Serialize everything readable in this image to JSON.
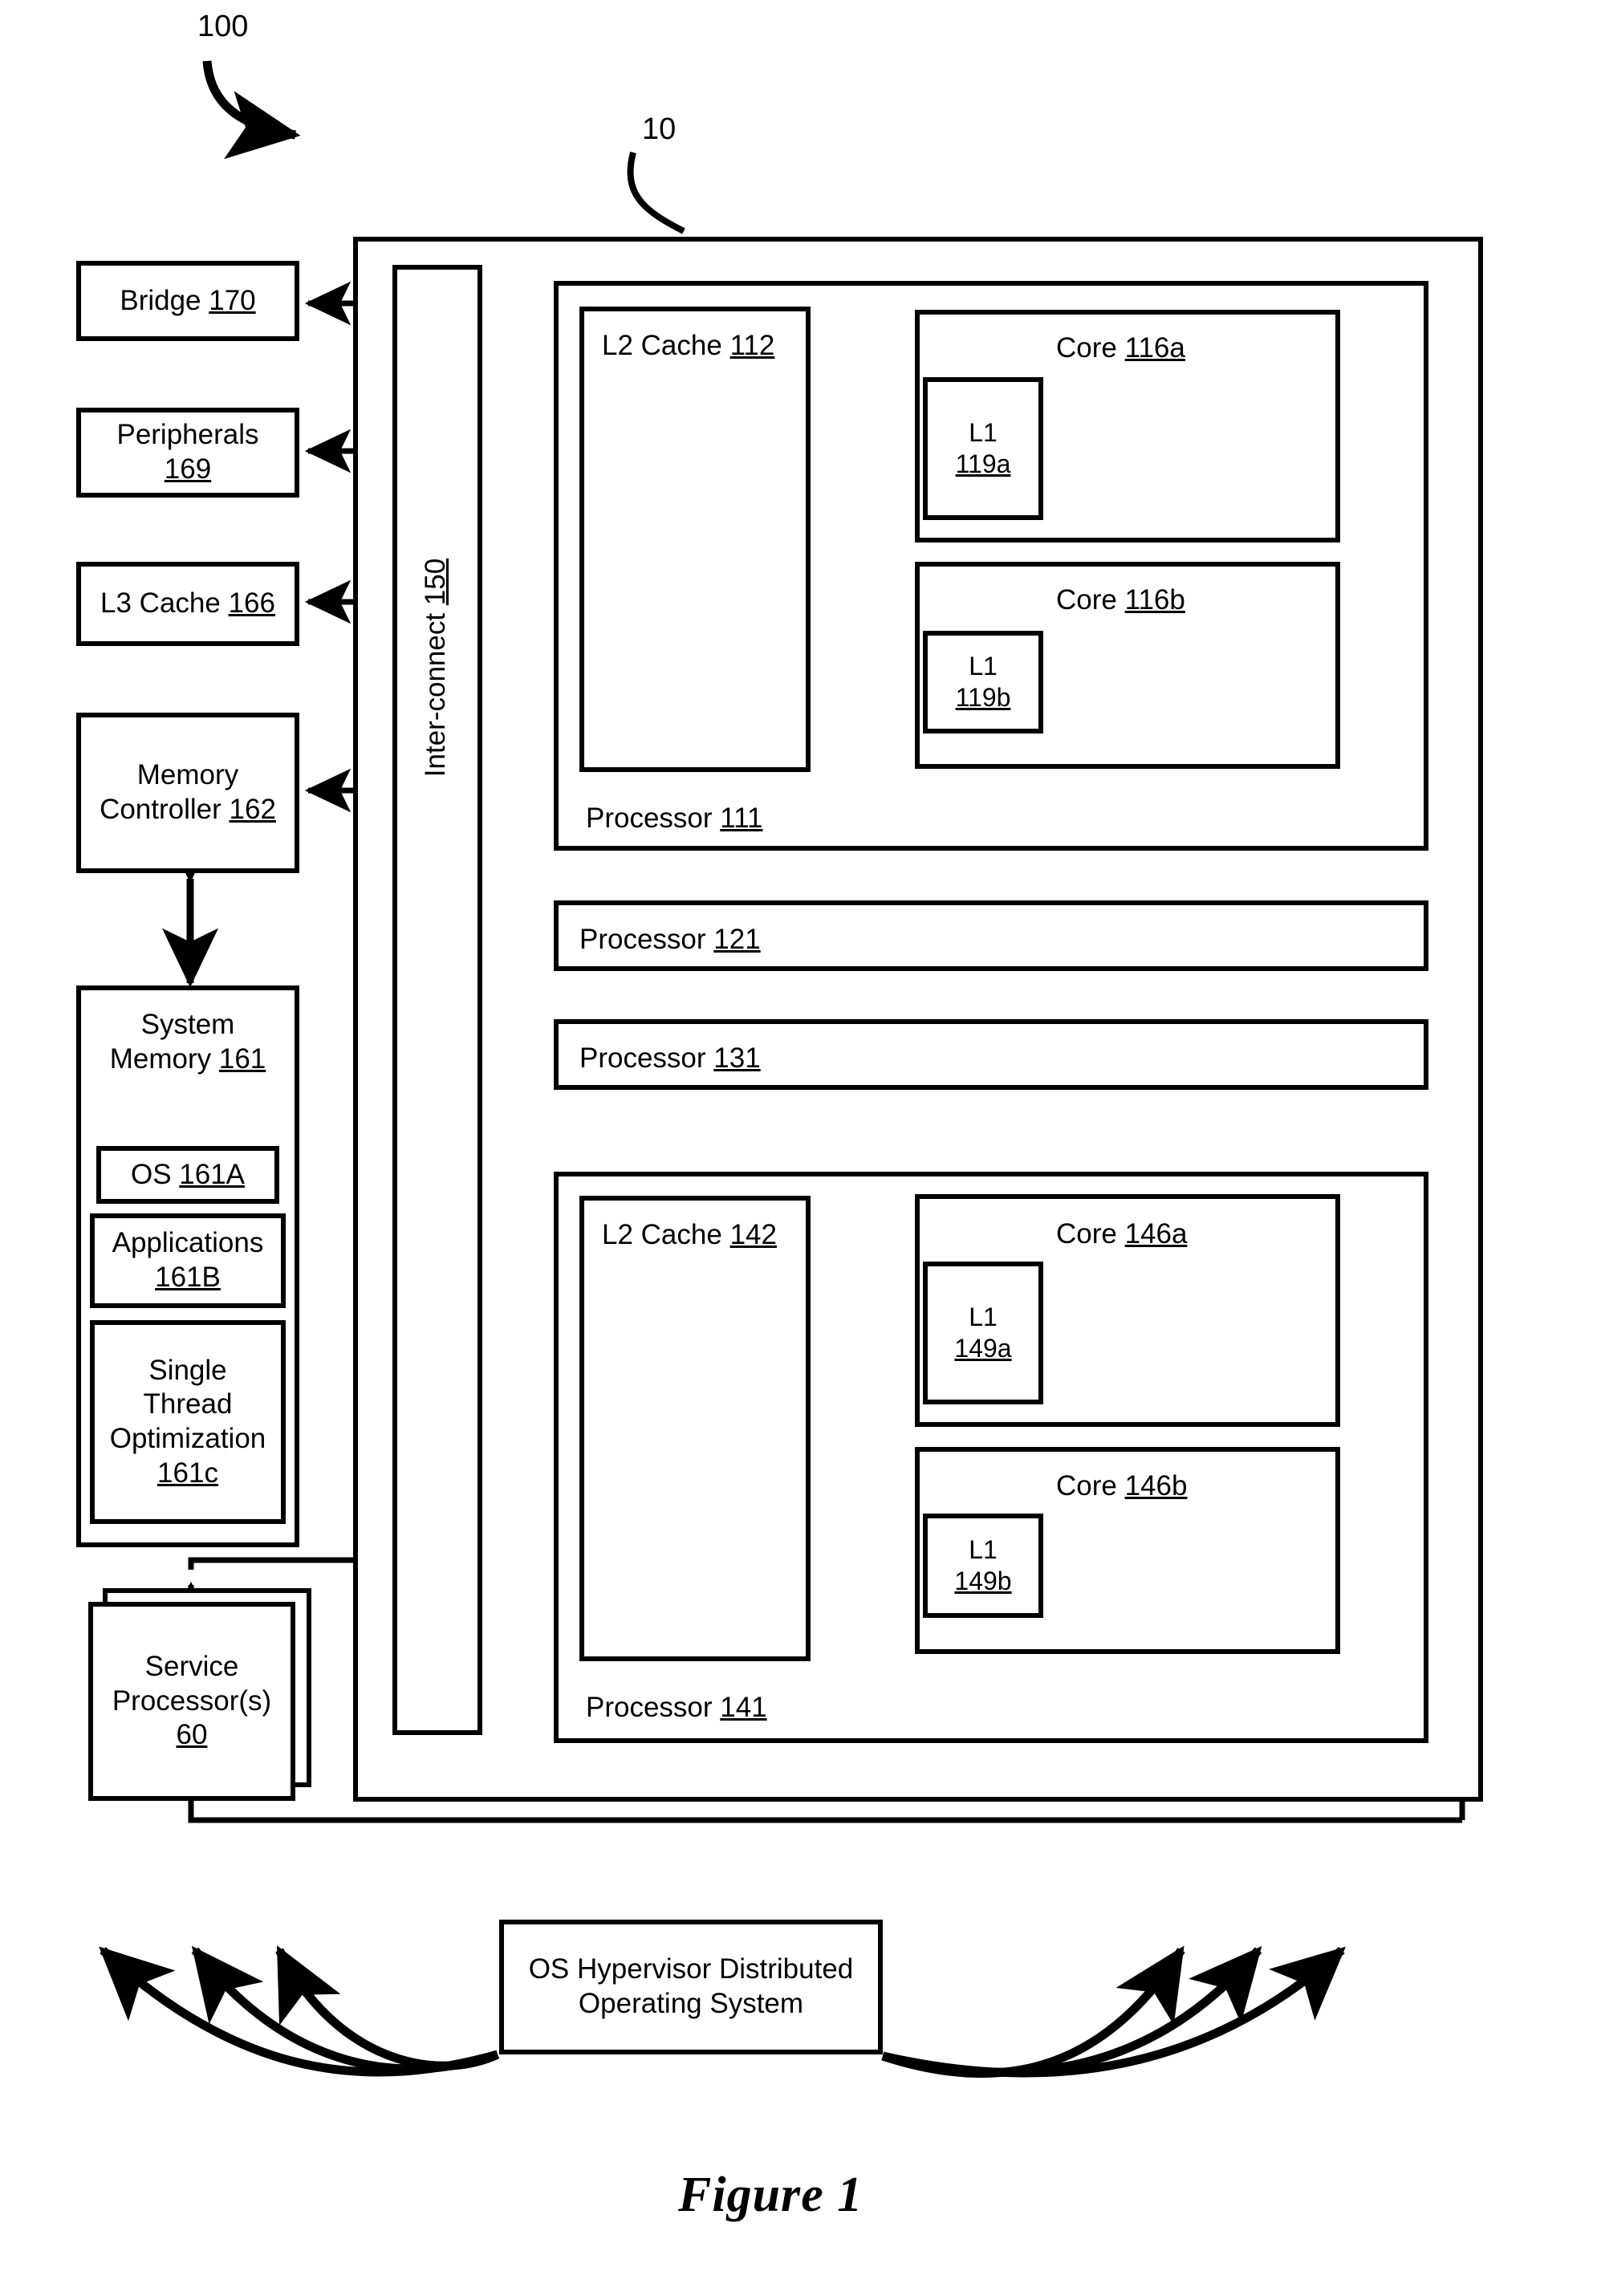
{
  "figure": {
    "caption": "Figure 1",
    "system_ref": "100",
    "chip_ref": "10"
  },
  "sidebar": {
    "items": [
      {
        "name": "bridge",
        "label": "Bridge ",
        "ref": "170"
      },
      {
        "name": "peripherals",
        "label": "Peripherals",
        "ref": "169"
      },
      {
        "name": "l3-cache",
        "label": "L3 Cache ",
        "ref": "166"
      },
      {
        "name": "memory-controller",
        "label_line1": "Memory",
        "label_line2": "Controller ",
        "ref": "162"
      }
    ],
    "system_memory": {
      "label_line1": "System",
      "label_line2": "Memory ",
      "ref": "161",
      "children": [
        {
          "name": "os",
          "label": "OS ",
          "ref": "161A"
        },
        {
          "name": "applications",
          "label": "Applications",
          "ref": "161B"
        },
        {
          "name": "single-thread-optimization",
          "label_line1": "Single",
          "label_line2": "Thread",
          "label_line3": "Optimization",
          "ref": "161c"
        }
      ]
    },
    "service_processor": {
      "label_line1": "Service",
      "label_line2": "Processor(s)",
      "ref": "60"
    }
  },
  "interconnect": {
    "label": "Inter-connect ",
    "ref": "150"
  },
  "processors": [
    {
      "name": "processor-111",
      "label": "Processor ",
      "ref": "111",
      "l2": {
        "label": "L2 Cache ",
        "ref": "112"
      },
      "cores": [
        {
          "label": "Core ",
          "ref": "116a",
          "l1_label": "L1",
          "l1_ref": "119a"
        },
        {
          "label": "Core ",
          "ref": "116b",
          "l1_label": "L1",
          "l1_ref": "119b"
        }
      ]
    },
    {
      "name": "processor-121",
      "label": "Processor ",
      "ref": "121"
    },
    {
      "name": "processor-131",
      "label": "Processor ",
      "ref": "131"
    },
    {
      "name": "processor-141",
      "label": "Processor ",
      "ref": "141",
      "l2": {
        "label": "L2 Cache ",
        "ref": "142"
      },
      "cores": [
        {
          "label": "Core ",
          "ref": "146a",
          "l1_label": "L1",
          "l1_ref": "149a"
        },
        {
          "label": "Core ",
          "ref": "146b",
          "l1_label": "L1",
          "l1_ref": "149b"
        }
      ]
    }
  ],
  "hypervisor": {
    "line1": "OS Hypervisor Distributed",
    "line2": "Operating System"
  },
  "colors": {
    "stroke": "#000000",
    "background": "#ffffff"
  }
}
